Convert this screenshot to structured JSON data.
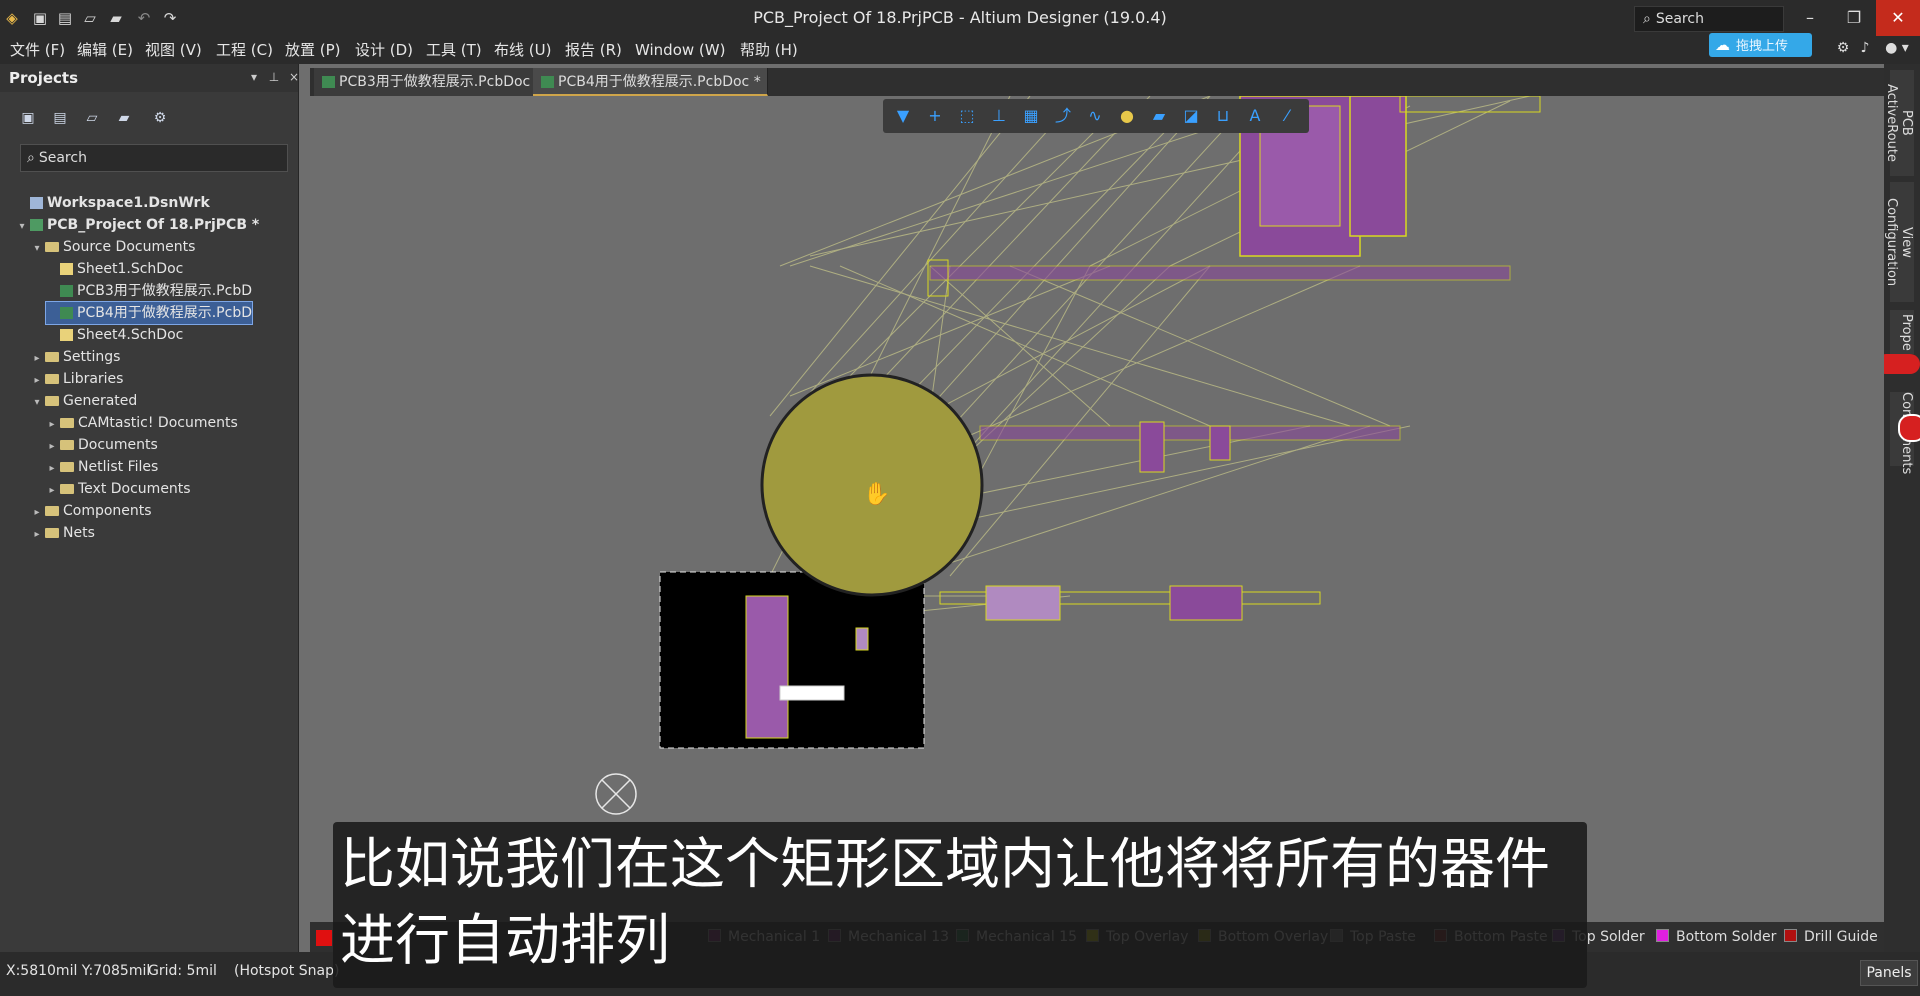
{
  "window": {
    "title": "PCB_Project Of 18.PrjPCB - Altium Designer (19.0.4)",
    "search_label": "Search",
    "minimize": "–",
    "maximize": "❐",
    "close": "✕"
  },
  "quick_access": [
    "save-icon",
    "save-all-icon",
    "open-icon",
    "open-project-icon",
    "undo-icon",
    "redo-icon"
  ],
  "menu": [
    "文件 (F)",
    "编辑 (E)",
    "视图 (V)",
    "工程 (C)",
    "放置 (P)",
    "设计 (D)",
    "工具 (T)",
    "布线 (U)",
    "报告 (R)",
    "Window (W)",
    "帮助 (H)"
  ],
  "upload_button": "拖拽上传",
  "projects_panel": {
    "title": "Projects",
    "search_placeholder": "Search",
    "tree": [
      {
        "label": "Workspace1.DsnWrk",
        "level": 0,
        "type": "workspace",
        "bold": true
      },
      {
        "label": "PCB_Project Of 18.PrjPCB *",
        "level": 0,
        "type": "project",
        "bold": true,
        "expanded": true
      },
      {
        "label": "Source Documents",
        "level": 1,
        "type": "folder",
        "expanded": true
      },
      {
        "label": "Sheet1.SchDoc",
        "level": 2,
        "type": "sch"
      },
      {
        "label": "PCB3用于做教程展示.PcbD",
        "level": 2,
        "type": "pcb"
      },
      {
        "label": "PCB4用于做教程展示.PcbD",
        "level": 2,
        "type": "pcb",
        "selected": true
      },
      {
        "label": "Sheet4.SchDoc",
        "level": 2,
        "type": "sch"
      },
      {
        "label": "Settings",
        "level": 1,
        "type": "folder"
      },
      {
        "label": "Libraries",
        "level": 1,
        "type": "folder"
      },
      {
        "label": "Generated",
        "level": 1,
        "type": "folder",
        "expanded": true
      },
      {
        "label": "CAMtastic! Documents",
        "level": 2,
        "type": "folder"
      },
      {
        "label": "Documents",
        "level": 2,
        "type": "folder"
      },
      {
        "label": "Netlist Files",
        "level": 2,
        "type": "folder"
      },
      {
        "label": "Text Documents",
        "level": 2,
        "type": "folder"
      },
      {
        "label": "Components",
        "level": 1,
        "type": "folder"
      },
      {
        "label": "Nets",
        "level": 1,
        "type": "folder"
      }
    ]
  },
  "tabs": [
    {
      "label": "PCB3用于做教程展示.PcbDoc *",
      "active": false
    },
    {
      "label": "PCB4用于做教程展示.PcbDoc *",
      "active": true
    }
  ],
  "right_dock": [
    "PCB ActiveRoute",
    "View Configuration",
    "Prope",
    "Components"
  ],
  "layers": [
    {
      "name": "Mechanical 1",
      "color": "#7a1f6a"
    },
    {
      "name": "Mechanical 13",
      "color": "#6a1f6e"
    },
    {
      "name": "Mechanical 15",
      "color": "#1f6e3a"
    },
    {
      "name": "Top Overlay",
      "color": "#c8c800"
    },
    {
      "name": "Bottom Overlay",
      "color": "#9a9a00"
    },
    {
      "name": "Top Paste",
      "color": "#777777"
    },
    {
      "name": "Bottom Paste",
      "color": "#7a1f1f"
    },
    {
      "name": "Top Solder",
      "color": "#6a2a8e"
    },
    {
      "name": "Bottom Solder",
      "color": "#e020e0"
    },
    {
      "name": "Drill Guide",
      "color": "#b01010"
    }
  ],
  "status": {
    "coords": "X:5810mil Y:7085mil",
    "grid": "Grid: 5mil",
    "snap": "(Hotspot Snap)",
    "panels": "Panels"
  },
  "subtitle": "比如说我们在这个矩形区域内让他将将所有的器件进行自动排列"
}
